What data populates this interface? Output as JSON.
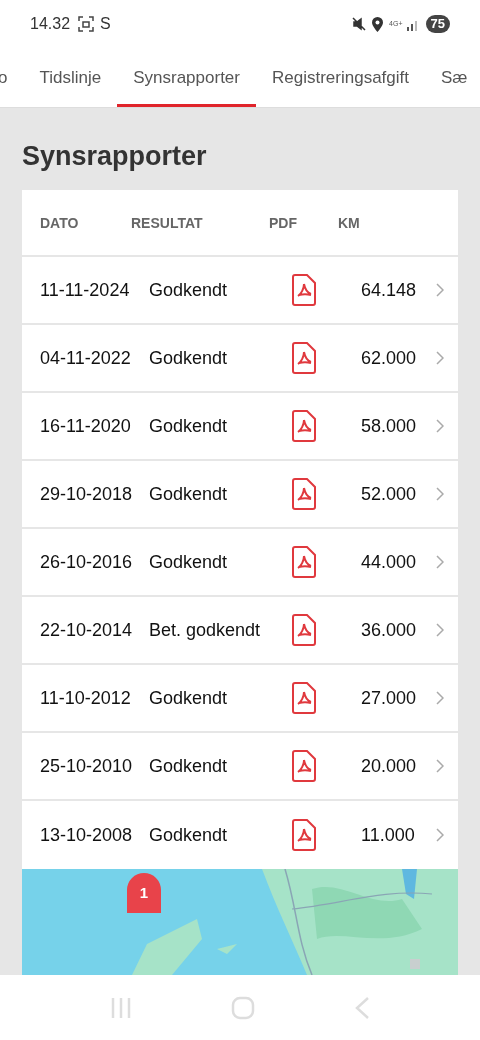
{
  "status_bar": {
    "time": "14.32",
    "carrier_letter": "S",
    "network": "4G+",
    "battery": "75"
  },
  "tabs": [
    {
      "label": "o",
      "selected": false
    },
    {
      "label": "Tidslinje",
      "selected": false
    },
    {
      "label": "Synsrapporter",
      "selected": true
    },
    {
      "label": "Registreringsafgift",
      "selected": false
    },
    {
      "label": "Sæ",
      "selected": false
    }
  ],
  "heading": "Synsrapporter",
  "table": {
    "columns": [
      "DATO",
      "RESULTAT",
      "PDF",
      "KM"
    ],
    "rows": [
      {
        "date": "11-11-2024",
        "result": "Godkendt",
        "km": "64.148"
      },
      {
        "date": "04-11-2022",
        "result": "Godkendt",
        "km": "62.000"
      },
      {
        "date": "16-11-2020",
        "result": "Godkendt",
        "km": "58.000"
      },
      {
        "date": "29-10-2018",
        "result": "Godkendt",
        "km": "52.000"
      },
      {
        "date": "26-10-2016",
        "result": "Godkendt",
        "km": "44.000"
      },
      {
        "date": "22-10-2014",
        "result": "Bet. godkendt",
        "km": "36.000"
      },
      {
        "date": "11-10-2012",
        "result": "Godkendt",
        "km": "27.000"
      },
      {
        "date": "25-10-2010",
        "result": "Godkendt",
        "km": "20.000"
      },
      {
        "date": "13-10-2008",
        "result": "Godkendt",
        "km": "11.000"
      }
    ]
  },
  "map": {
    "kind": "picture",
    "marker_label": "1"
  }
}
